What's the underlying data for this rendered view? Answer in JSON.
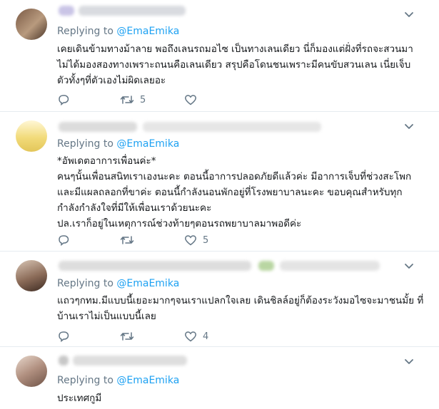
{
  "colors": {
    "link": "#1da1f2",
    "muted": "#657786",
    "text": "#14171a",
    "divider": "#e6ecf0"
  },
  "icons": {
    "menu": "chevron-down-icon",
    "reply": "reply-icon",
    "retweet": "retweet-icon",
    "like": "heart-icon"
  },
  "tweets": [
    {
      "reply_prefix": "Replying to",
      "reply_handle": "@EmaEmika",
      "text": "เคยเดินข้ามทางม้าลาย พอถึงเลนรถมอไซ เป็นทางเลนเดียว นี่ก็มองแต่ฝั่งที่รถจะสวนมา\nไม่ได้มองสองทางเพราะถนนคือเลนเดียว สรุปคือโดนชนเพราะมีคนขับสวนเลน เนี่ยเจ็บ\nตัวทั้งๆที่ตัวเองไม่ผิดเลยอะ",
      "retweets": "5",
      "likes": ""
    },
    {
      "reply_prefix": "Replying to",
      "reply_handle": "@EmaEmika",
      "text": "*อัพเดตอาการเพื่อนค่ะ*\nคนๆนั้นเพื่อนสนิทเราเองนะคะ ตอนนี้อาการปลอดภัยดีแล้วค่ะ มีอาการเจ็บที่ช่วงสะโพก\nและมีแผลถลอกที่ขาค่ะ ตอนนี้กำลังนอนพักอยู่ที่โรงพยาบาลนะคะ ขอบคุณสำหรับทุก\nกำลังกำลังใจที่มีให้เพื่อนเราด้วยนะคะ\nปล.เราก็อยู่ในเหตุการณ์ช่วงท้ายๆตอนรถพยาบาลมาพอดีค่ะ",
      "retweets": "",
      "likes": "5"
    },
    {
      "reply_prefix": "Replying to",
      "reply_handle": "@EmaEmika",
      "text": "แถวๆกทม.มีแบบนี้เยอะมากๆจนเราแปลกใจเลย เดินชิลล์อยู่ก็ต้องระวังมอไซจะมาชนมั้ย ที่\nบ้านเราไม่เป็นแบบนี้เลย",
      "retweets": "",
      "likes": "4"
    },
    {
      "reply_prefix": "Replying to",
      "reply_handle": "@EmaEmika",
      "text": "ประเทศกูมี"
    }
  ]
}
